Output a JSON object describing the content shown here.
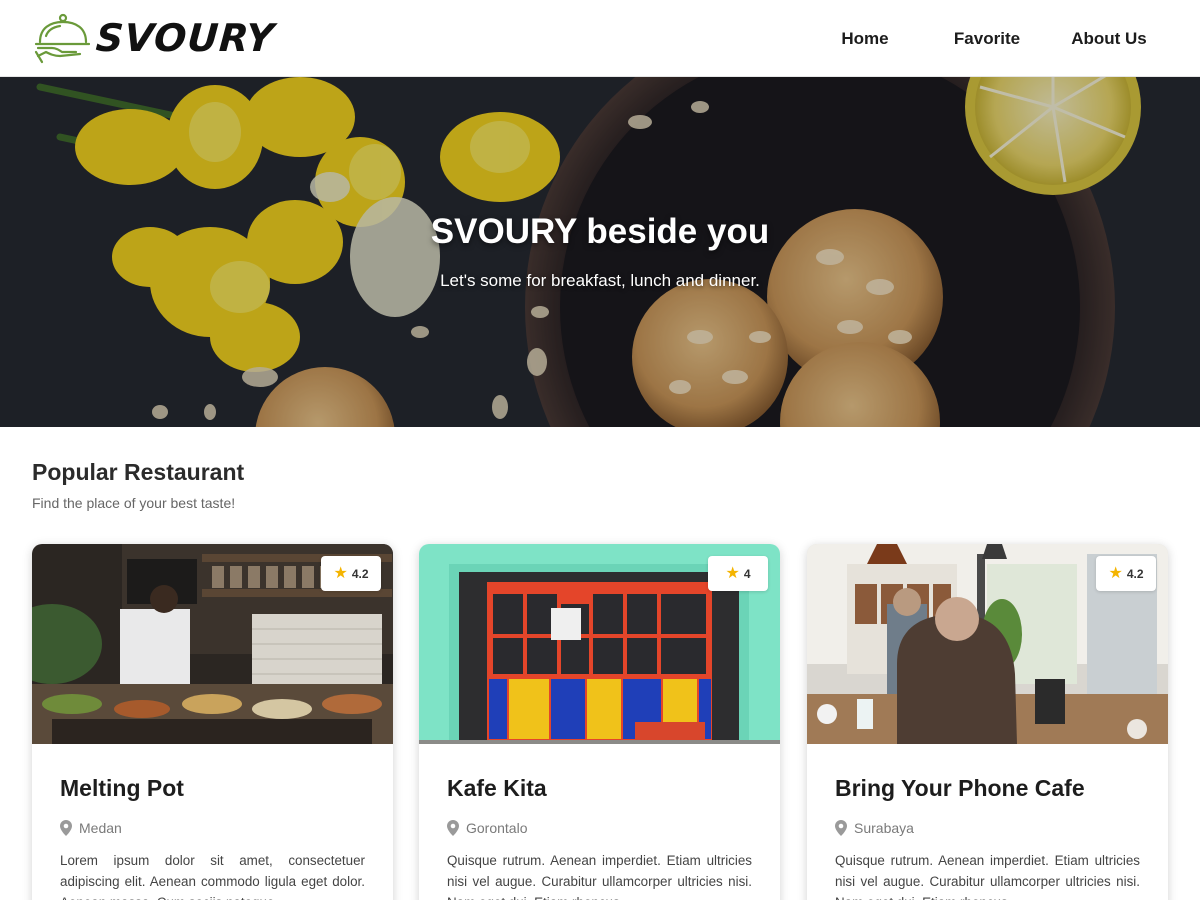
{
  "brand": {
    "name": "SVOURY",
    "logo_icon": "serving-cloche-icon",
    "logo_color": "#6a9a3a"
  },
  "nav": {
    "items": [
      "Home",
      "Favorite",
      "About Us"
    ]
  },
  "hero": {
    "title": "SVOURY beside you",
    "subtitle": "Let's some for breakfast, lunch and dinner."
  },
  "section": {
    "title": "Popular Restaurant",
    "subtitle": "Find the place of your best taste!"
  },
  "restaurants": [
    {
      "name": "Melting Pot",
      "city": "Medan",
      "rating": "4.2",
      "description": "Lorem ipsum dolor sit amet, consectetuer adipiscing elit. Aenean commodo ligula eget dolor. Aenean massa. Cum sociis natoque"
    },
    {
      "name": "Kafe Kita",
      "city": "Gorontalo",
      "rating": "4",
      "description": "Quisque rutrum. Aenean imperdiet. Etiam ultricies nisi vel augue. Curabitur ullamcorper ultricies nisi. Nam eget dui. Etiam rhoncus"
    },
    {
      "name": "Bring Your Phone Cafe",
      "city": "Surabaya",
      "rating": "4.2",
      "description": "Quisque rutrum. Aenean imperdiet. Etiam ultricies nisi vel augue. Curabitur ullamcorper ultricies nisi. Nam eget dui. Etiam rhoncus"
    }
  ],
  "colors": {
    "star": "#f4b400",
    "text_dark": "#1d1d1d",
    "text_muted": "#7a7a7a"
  }
}
